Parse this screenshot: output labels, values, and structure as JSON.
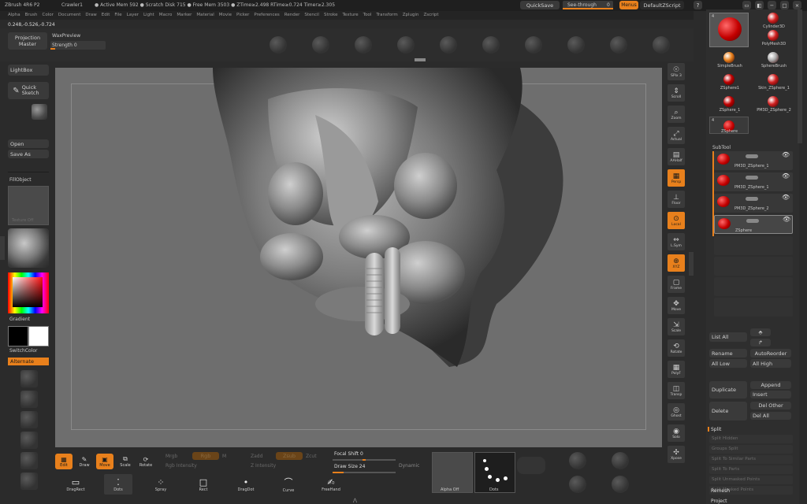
{
  "titlebar": {
    "app": "ZBrush 4R6 P2",
    "doc": "Crawler1",
    "stats": "● Active Mem 592 ● Scratch Disk 715 ● Free Mem 3503 ● ZTime≥2.498 RTime≥0.724 Timer≥2.305",
    "quicksave": "QuickSave",
    "seethrough": "See-through",
    "seethrough_val": "0",
    "menus": "Menus",
    "defaultscript": "DefaultZScript"
  },
  "menubar": [
    "Alpha",
    "Brush",
    "Color",
    "Document",
    "Draw",
    "Edit",
    "File",
    "Layer",
    "Light",
    "Macro",
    "Marker",
    "Material",
    "Movie",
    "Picker",
    "Preferences",
    "Render",
    "Stencil",
    "Stroke",
    "Texture",
    "Tool",
    "Transform",
    "Zplugin",
    "Zscript"
  ],
  "coords": "0.248,-0.526,-0.724",
  "top_shelf": {
    "projection_master": "Projection Master",
    "waxpreview": "WaxPreview",
    "strength": "Strength 0"
  },
  "left": {
    "lightbox": "LightBox",
    "quick_sketch": "Quick Sketch",
    "open": "Open",
    "save_as": "Save As",
    "fill_object": "FillObject",
    "texture_off": "Texture Off",
    "gradient": "Gradient",
    "switchcolor": "SwitchColor",
    "alternate": "Alternate",
    "accent_color": "#e8801c"
  },
  "right_shelf": [
    "SPix 3",
    "Scroll",
    "Zoom",
    "Actual",
    "AAHalf",
    "Persp",
    "Floor",
    "Local",
    "L.Sym",
    "XYZ",
    "Frame",
    "Move",
    "Scale",
    "Rotate",
    "PolyF",
    "Transp",
    "Ghost",
    "Solo",
    "Xpose"
  ],
  "tool_palette": {
    "items": [
      "Cylinder3D",
      "PolyMesh3D",
      "SimpleBrush",
      "SphereBrush",
      "ZSphere1",
      "Skin_ZSphere_1",
      "ZSphere_1",
      "PM3D_ZSphere_2",
      "ZSphere"
    ],
    "count_badge": "4",
    "current_label": "ZSphere",
    "current_count": "4"
  },
  "subtool": {
    "header": "SubTool",
    "rows": [
      "PM3D_ZSphere_1",
      "PM3D_ZSphere_1",
      "PM3D_ZSphere_2",
      "ZSphere"
    ],
    "list_all": "List All",
    "rename": "Rename",
    "autoreorder": "AutoReorder",
    "all_low": "All Low",
    "all_high": "All High",
    "duplicate": "Duplicate",
    "append": "Append",
    "insert": "Insert",
    "delete": "Delete",
    "del_other": "Del Other",
    "del_all": "Del All",
    "split": "Split",
    "split_items": [
      "Split Hidden",
      "Groups Split",
      "Split To Similar Parts",
      "Split To Parts",
      "Split Unmasked Points",
      "Split Masked Points"
    ],
    "remesh": "Remesh",
    "project": "Project"
  },
  "bottom": {
    "edit": "Edit",
    "draw": "Draw",
    "move": "Move",
    "scale": "Scale",
    "rotate": "Rotate",
    "mrgb": "Mrgb",
    "rgb": "Rgb",
    "m": "M",
    "zadd": "Zadd",
    "zsub": "Zsub",
    "zcut": "Zcut",
    "rgb_intensity": "Rgb Intensity",
    "z_intensity": "Z Intensity",
    "focal_shift": "Focal Shift 0",
    "draw_size": "Draw Size 24",
    "dynamic": "Dynamic",
    "strokes": [
      "DragRect",
      "Dots",
      "Spray",
      "Rect",
      "DragDot",
      "Curve",
      "FreeHand"
    ],
    "alpha_off": "Alpha Off",
    "dots": "Dots"
  }
}
